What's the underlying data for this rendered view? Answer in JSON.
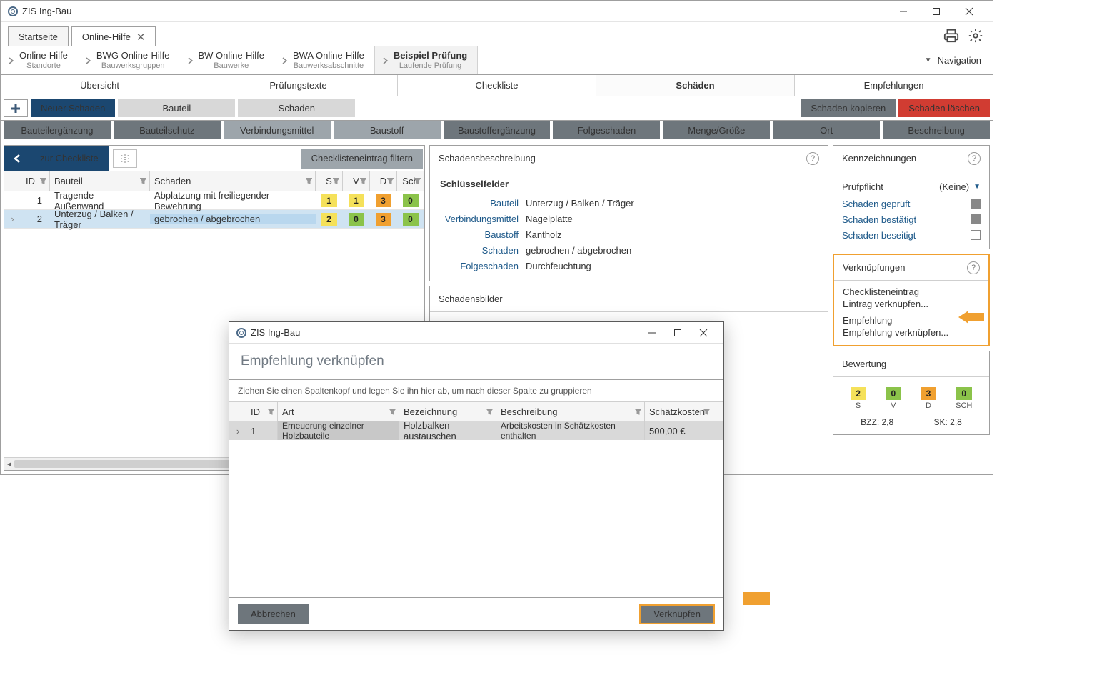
{
  "titlebar": {
    "title": "ZIS Ing-Bau"
  },
  "tabs": [
    {
      "label": "Startseite",
      "active": false,
      "closable": false
    },
    {
      "label": "Online-Hilfe",
      "active": true,
      "closable": true
    }
  ],
  "breadcrumb": [
    {
      "title": "Online-Hilfe",
      "sub": "Standorte"
    },
    {
      "title": "BWG Online-Hilfe",
      "sub": "Bauwerksgruppen"
    },
    {
      "title": "BW Online-Hilfe",
      "sub": "Bauwerke"
    },
    {
      "title": "BWA Online-Hilfe",
      "sub": "Bauwerksabschnitte"
    },
    {
      "title": "Beispiel Prüfung",
      "sub": "Laufende Prüfung",
      "current": true
    }
  ],
  "nav_toggle": "Navigation",
  "section_tabs": [
    "Übersicht",
    "Prüfungstexte",
    "Checkliste",
    "Schäden",
    "Empfehlungen"
  ],
  "section_active": "Schäden",
  "toolbar": {
    "new": "Neuer Schaden",
    "bauteil": "Bauteil",
    "schaden": "Schaden",
    "copy": "Schaden kopieren",
    "delete": "Schaden löschen"
  },
  "attr_tabs": [
    "Bauteilergänzung",
    "Bauteilschutz",
    "Verbindungsmittel",
    "Baustoff",
    "Baustoffergänzung",
    "Folgeschaden",
    "Menge/Größe",
    "Ort",
    "Beschreibung"
  ],
  "attr_light": [
    2,
    3
  ],
  "left": {
    "back": "zur Checkliste",
    "filter": "Checklisteneintrag filtern",
    "cols": {
      "id": "ID",
      "bauteil": "Bauteil",
      "schaden": "Schaden",
      "s": "S",
      "v": "V",
      "d": "D",
      "sch": "Sch"
    },
    "rows": [
      {
        "id": "1",
        "bauteil": "Tragende Außenwand",
        "schaden": "Abplatzung mit freiliegender Bewehrung",
        "s": "1",
        "v": "1",
        "d": "3",
        "sch": "0",
        "sc": "y",
        "vc": "y",
        "dc": "o",
        "schc": "g"
      },
      {
        "id": "2",
        "bauteil": "Unterzug / Balken / Träger",
        "schaden": "gebrochen / abgebrochen",
        "s": "2",
        "v": "0",
        "d": "3",
        "sch": "0",
        "sc": "y",
        "vc": "g",
        "dc": "o",
        "schc": "g",
        "selected": true
      }
    ]
  },
  "desc": {
    "title": "Schadensbeschreibung",
    "section": "Schlüsselfelder",
    "kv": [
      {
        "k": "Bauteil",
        "v": "Unterzug / Balken / Träger"
      },
      {
        "k": "Verbindungsmittel",
        "v": "Nagelplatte"
      },
      {
        "k": "Baustoff",
        "v": "Kantholz"
      },
      {
        "k": "Schaden",
        "v": "gebrochen / abgebrochen"
      },
      {
        "k": "Folgeschaden",
        "v": "Durchfeuchtung"
      }
    ]
  },
  "images_panel": "Schadensbilder",
  "kenn": {
    "title": "Kennzeichnungen",
    "pflicht_lbl": "Prüfpflicht",
    "pflicht_val": "(Keine)",
    "rows": [
      {
        "lbl": "Schaden geprüft",
        "checked": true
      },
      {
        "lbl": "Schaden bestätigt",
        "checked": true
      },
      {
        "lbl": "Schaden beseitigt",
        "checked": false
      }
    ]
  },
  "verk": {
    "title": "Verknüpfungen",
    "chk_lbl": "Checklisteneintrag",
    "chk_sub": "Eintrag verknüpfen...",
    "emp_lbl": "Empfehlung",
    "emp_sub": "Empfehlung verknüpfen..."
  },
  "bewert": {
    "title": "Bewertung",
    "items": [
      {
        "v": "2",
        "c": "y",
        "l": "S"
      },
      {
        "v": "0",
        "c": "g",
        "l": "V"
      },
      {
        "v": "3",
        "c": "o",
        "l": "D"
      },
      {
        "v": "0",
        "c": "g",
        "l": "SCH"
      }
    ],
    "bzz": "BZZ: 2,8",
    "sk": "SK: 2,8"
  },
  "modal": {
    "title": "ZIS Ing-Bau",
    "heading": "Empfehlung verknüpfen",
    "group_hint": "Ziehen Sie einen Spaltenkopf und legen Sie ihn hier ab, um nach dieser Spalte zu gruppieren",
    "cols": {
      "id": "ID",
      "art": "Art",
      "bez": "Bezeichnung",
      "besch": "Beschreibung",
      "kost": "Schätzkosten"
    },
    "row": {
      "id": "1",
      "art": "Erneuerung einzelner Holzbauteile",
      "bez": "Holzbalken austauschen",
      "besch": "Arbeitskosten in Schätzkosten enthalten",
      "kost": "500,00 €"
    },
    "cancel": "Abbrechen",
    "ok": "Verknüpfen"
  }
}
